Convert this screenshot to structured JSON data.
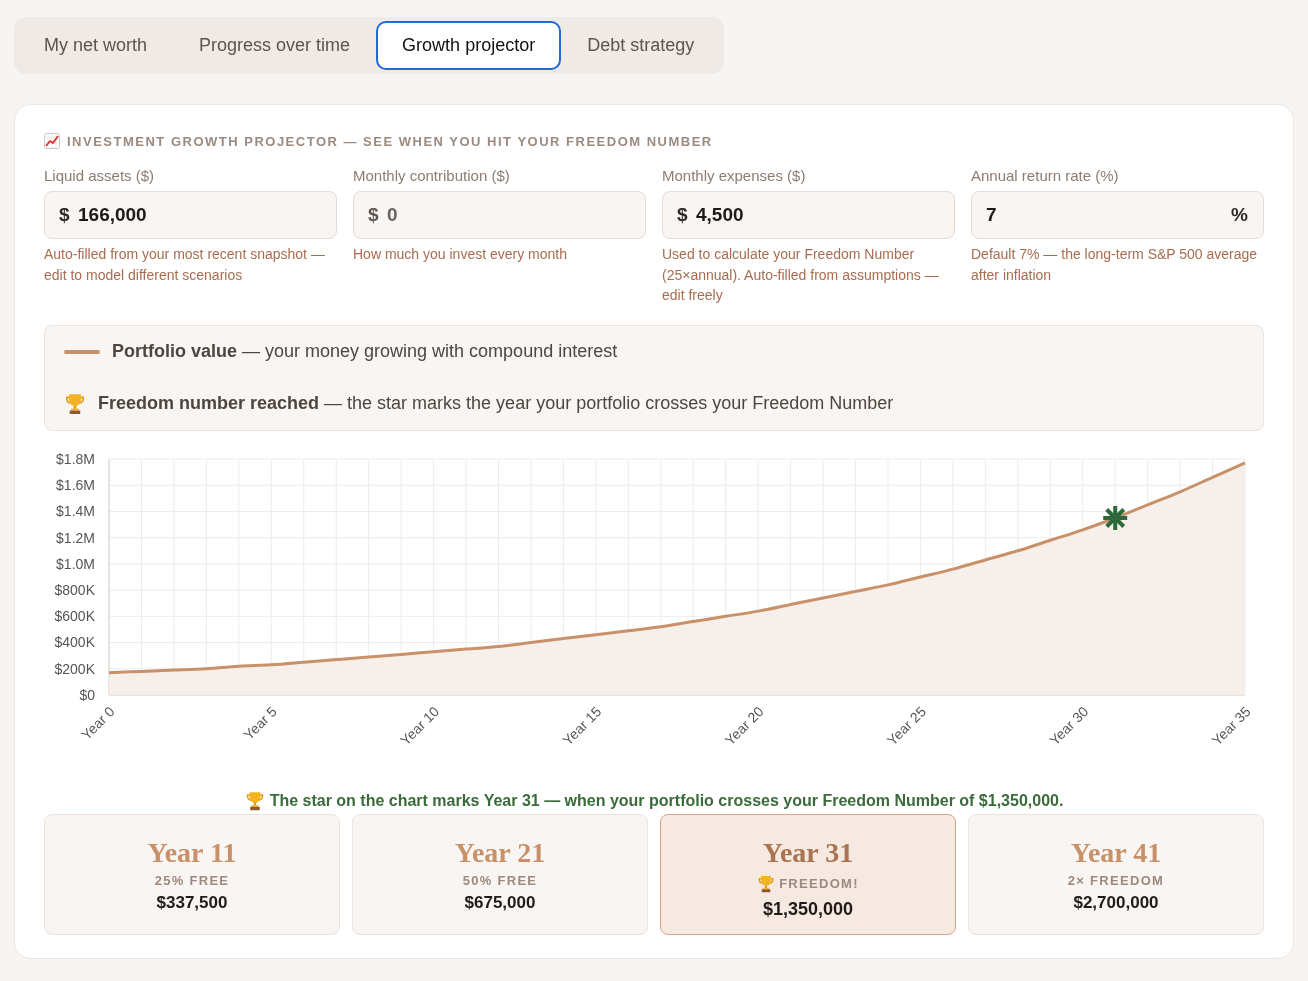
{
  "tabs": [
    {
      "label": "My net worth",
      "selected": false
    },
    {
      "label": "Progress over time",
      "selected": false
    },
    {
      "label": "Growth projector",
      "selected": true
    },
    {
      "label": "Debt strategy",
      "selected": false
    }
  ],
  "projector": {
    "title": "INVESTMENT GROWTH PROJECTOR — SEE WHEN YOU HIT YOUR FREEDOM NUMBER",
    "fields": [
      {
        "label": "Liquid assets ($)",
        "prefix": "$",
        "value": "166,000",
        "hint": "Auto-filled from your most recent snapshot — edit to model different scenarios"
      },
      {
        "label": "Monthly contribution ($)",
        "prefix": "$",
        "placeholder": "0",
        "hint": "How much you invest every month"
      },
      {
        "label": "Monthly expenses ($)",
        "prefix": "$",
        "value": "4,500",
        "hint": "Used to calculate your Freedom Number (25×annual). Auto-filled from assumptions — edit freely"
      },
      {
        "label": "Annual return rate (%)",
        "value": "7",
        "suffix": "%",
        "hint": "Default 7% — the long-term S&P 500 average after inflation"
      }
    ],
    "legend": [
      {
        "kind": "line",
        "text": "**Portfolio value** — your money growing with compound interest"
      },
      {
        "kind": "trophy",
        "text": "**Freedom number reached** — the star marks the year your portfolio crosses your Freedom Number"
      }
    ],
    "chart_data": {
      "type": "area",
      "categories": [
        "Year 0",
        null,
        null,
        null,
        null,
        "Year 5",
        null,
        null,
        null,
        null,
        "Year 10",
        null,
        null,
        null,
        null,
        "Year 15",
        null,
        null,
        null,
        null,
        "Year 20",
        null,
        null,
        null,
        null,
        "Year 25",
        null,
        null,
        null,
        null,
        "Year 30",
        null,
        null,
        null,
        null,
        "Year 35"
      ],
      "series": [
        {
          "color": "#c8916a",
          "values": [
            170000,
            180000,
            190000,
            200000,
            220000,
            230000,
            250000,
            270000,
            290000,
            310000,
            330000,
            350000,
            370000,
            400000,
            430000,
            460000,
            490000,
            520000,
            560000,
            600000,
            640000,
            690000,
            740000,
            790000,
            840000,
            900000,
            960000,
            1030000,
            1100000,
            1180000,
            1260000,
            1350000,
            1450000,
            1550000,
            1660000,
            1770000
          ]
        },
        {
          "type": "scatter",
          "color": "#2c6a3b",
          "values": [
            null,
            null,
            null,
            null,
            null,
            null,
            null,
            null,
            null,
            null,
            null,
            null,
            null,
            null,
            null,
            null,
            null,
            null,
            null,
            null,
            null,
            null,
            null,
            null,
            null,
            null,
            null,
            null,
            null,
            null,
            null,
            1350000,
            null,
            null,
            null,
            null
          ]
        }
      ],
      "ylim": [
        0,
        1800000
      ],
      "yticks": [
        {
          "value": 0,
          "label": "$0"
        },
        {
          "value": 200000,
          "label": "$200K"
        },
        {
          "value": 400000,
          "label": "$400K"
        },
        {
          "value": 600000,
          "label": "$600K"
        },
        {
          "value": 800000,
          "label": "$800K"
        },
        {
          "value": 1000000,
          "label": "$1.0M"
        },
        {
          "value": 1200000,
          "label": "$1.2M"
        },
        {
          "value": 1400000,
          "label": "$1.4M"
        },
        {
          "value": 1600000,
          "label": "$1.6M"
        },
        {
          "value": 1800000,
          "label": "$1.8M"
        }
      ],
      "grid": true
    },
    "message": "The star on the chart marks Year 31 — when your portfolio crosses your Freedom Number of $1,350,000.",
    "milestones": [
      {
        "title": "Year 11",
        "label": "25% FREE",
        "amount": "$337,500",
        "highlighted": false
      },
      {
        "title": "Year 21",
        "label": "50% FREE",
        "amount": "$675,000",
        "highlighted": false
      },
      {
        "title": "Year 31",
        "label": "FREEDOM!",
        "amount": "$1,350,000",
        "highlighted": true
      },
      {
        "title": "Year 41",
        "label": "2× FREEDOM",
        "amount": "$2,700,000",
        "highlighted": false
      }
    ]
  }
}
